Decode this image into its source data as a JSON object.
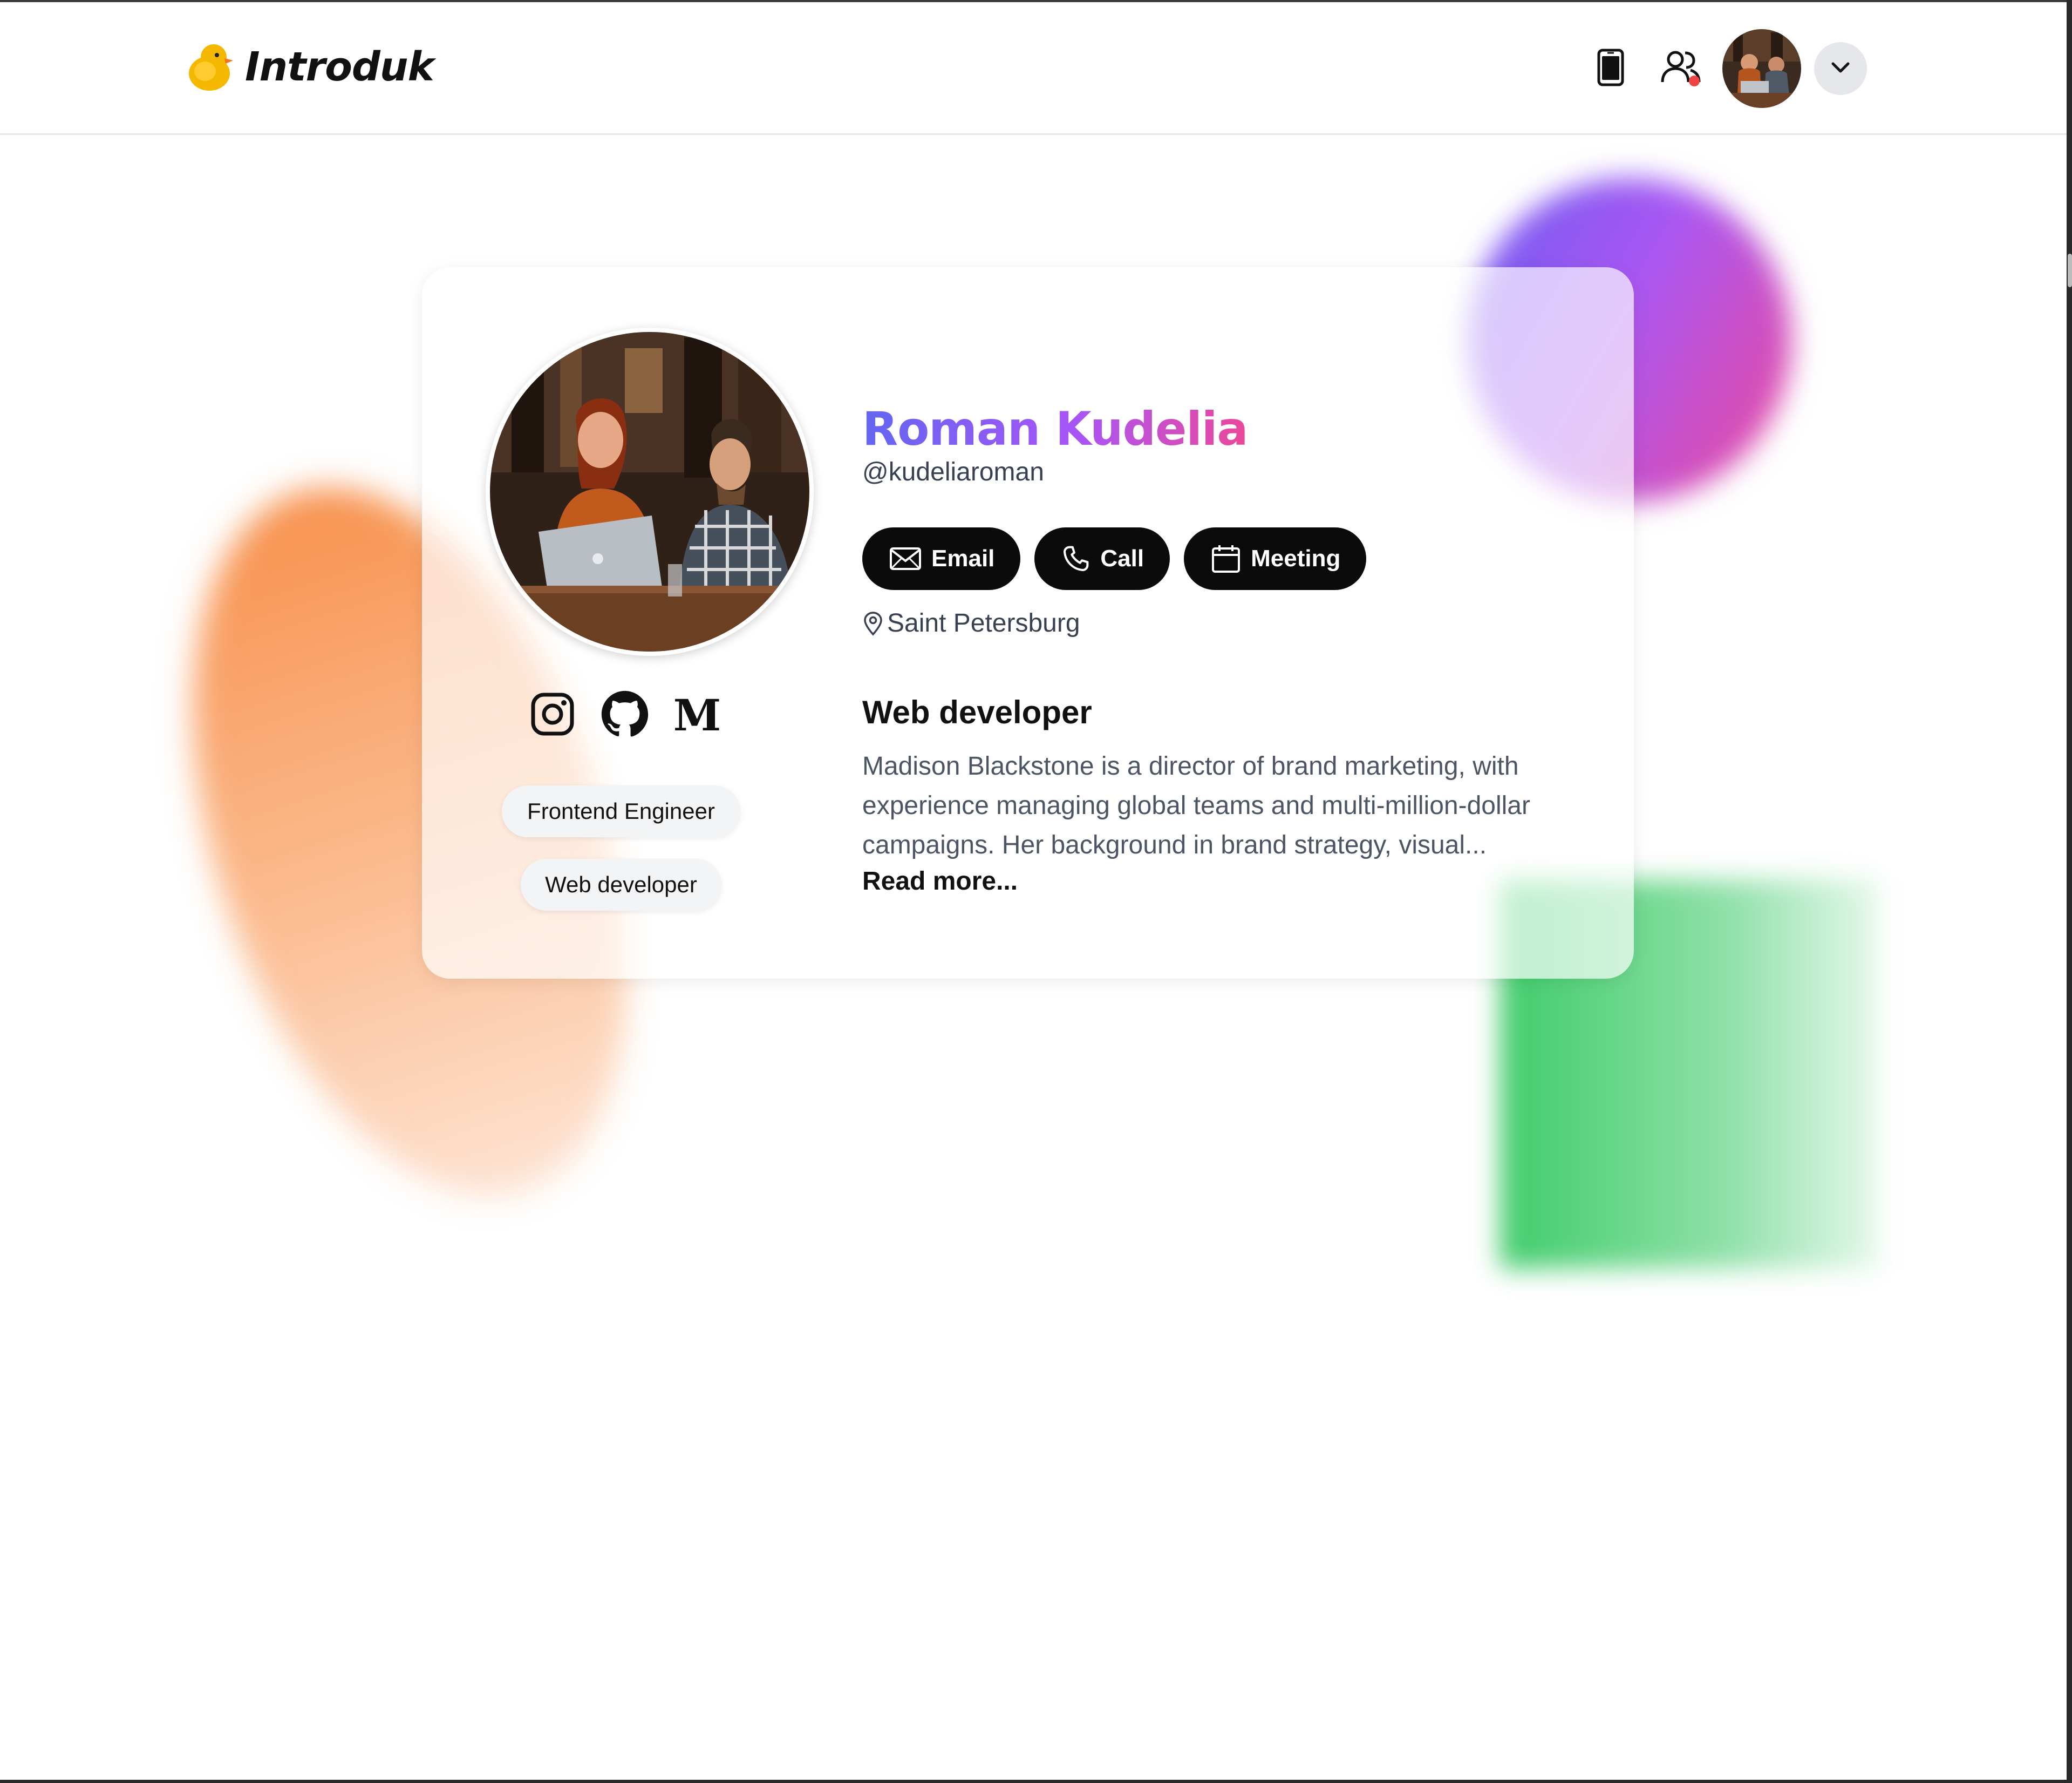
{
  "header": {
    "brand": "Introduk",
    "icons": [
      "duck-logo-icon",
      "phone-device-icon",
      "contacts-icon",
      "chevron-down-icon"
    ],
    "has_notification": true
  },
  "profile": {
    "name": "Roman Kudelia",
    "handle": "@kudeliaroman",
    "actions": {
      "email": "Email",
      "call": "Call",
      "meeting": "Meeting"
    },
    "location": "Saint Petersburg",
    "socials": [
      "instagram-icon",
      "github-icon",
      "medium-icon"
    ],
    "medium_letter": "M",
    "tags": [
      "Frontend Engineer",
      "Web developer"
    ],
    "bio_title": "Web developer",
    "bio": "Madison Blackstone is a director of brand marketing, with experience managing global teams and multi-million-dollar campaigns. Her background in brand strategy, visual...",
    "read_more": "Read more..."
  },
  "colors": {
    "name_gradient": [
      "#6366f1",
      "#a855f7",
      "#ec4899"
    ],
    "button_bg": "#0b0b0b",
    "notification": "#ef4444",
    "blob_purple": "#a957f2",
    "blob_orange": "#f7924f",
    "blob_green": "#3fcc6a"
  }
}
